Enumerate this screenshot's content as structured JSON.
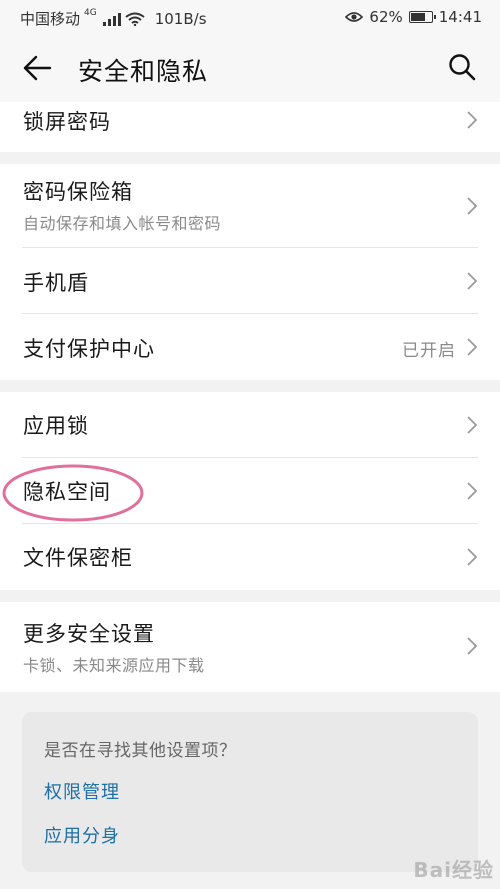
{
  "status_bar": {
    "carrier": "中国移动",
    "network_type": "4G",
    "speed": "101B/s",
    "battery_percent": "62%",
    "time": "14:41",
    "icons": [
      "signal-icon",
      "wifi-icon",
      "eye-comfort-icon",
      "battery-icon"
    ]
  },
  "header": {
    "title": "安全和隐私",
    "back_icon": "back-arrow-icon",
    "search_icon": "search-icon"
  },
  "sections": [
    {
      "items": [
        {
          "title": "锁屏密码"
        }
      ]
    },
    {
      "items": [
        {
          "title": "密码保险箱",
          "subtitle": "自动保存和填入帐号和密码"
        },
        {
          "title": "手机盾"
        },
        {
          "title": "支付保护中心",
          "status": "已开启"
        }
      ]
    },
    {
      "items": [
        {
          "title": "应用锁"
        },
        {
          "title": "隐私空间"
        },
        {
          "title": "文件保密柜"
        }
      ]
    },
    {
      "items": [
        {
          "title": "更多安全设置",
          "subtitle": "卡锁、未知来源应用下载"
        }
      ]
    }
  ],
  "suggestions": {
    "question": "是否在寻找其他设置项？",
    "links": [
      "权限管理",
      "应用分身"
    ]
  },
  "watermark": "Bai经验",
  "colors": {
    "link": "#1d6fa5",
    "annotation": "#e0709a",
    "background": "#f2f2f2"
  }
}
